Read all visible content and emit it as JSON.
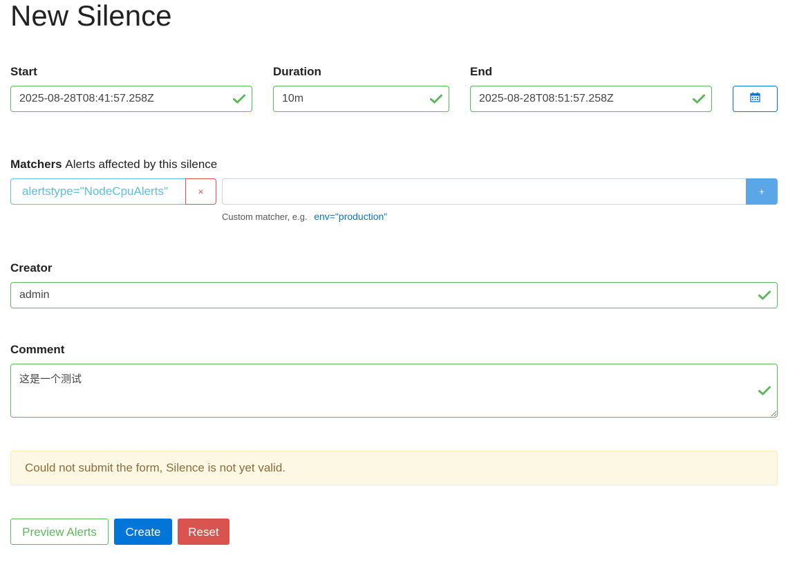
{
  "page": {
    "title": "New Silence"
  },
  "start": {
    "label": "Start",
    "value": "2025-08-28T08:41:57.258Z"
  },
  "duration": {
    "label": "Duration",
    "value": "10m"
  },
  "end": {
    "label": "End",
    "value": "2025-08-28T08:51:57.258Z"
  },
  "calendar": {
    "icon": "calendar-icon"
  },
  "matchers": {
    "label": "Matchers",
    "sublabel": "Alerts affected by this silence",
    "items": [
      {
        "text": "alertstype=\"NodeCpuAlerts\"",
        "remove_label": "×"
      }
    ],
    "input_value": "",
    "add_label": "+",
    "hint": "Custom matcher, e.g.",
    "hint_example": "env=\"production\""
  },
  "creator": {
    "label": "Creator",
    "value": "admin"
  },
  "comment": {
    "label": "Comment",
    "value": "这是一个测试"
  },
  "alert": {
    "message": "Could not submit the form, Silence is not yet valid."
  },
  "buttons": {
    "preview": "Preview Alerts",
    "create": "Create",
    "reset": "Reset"
  },
  "colors": {
    "valid": "#5cb85c",
    "primary": "#0275d8",
    "danger": "#d9534f",
    "info": "#5bc0de",
    "warning_bg": "#fcf8e3"
  }
}
